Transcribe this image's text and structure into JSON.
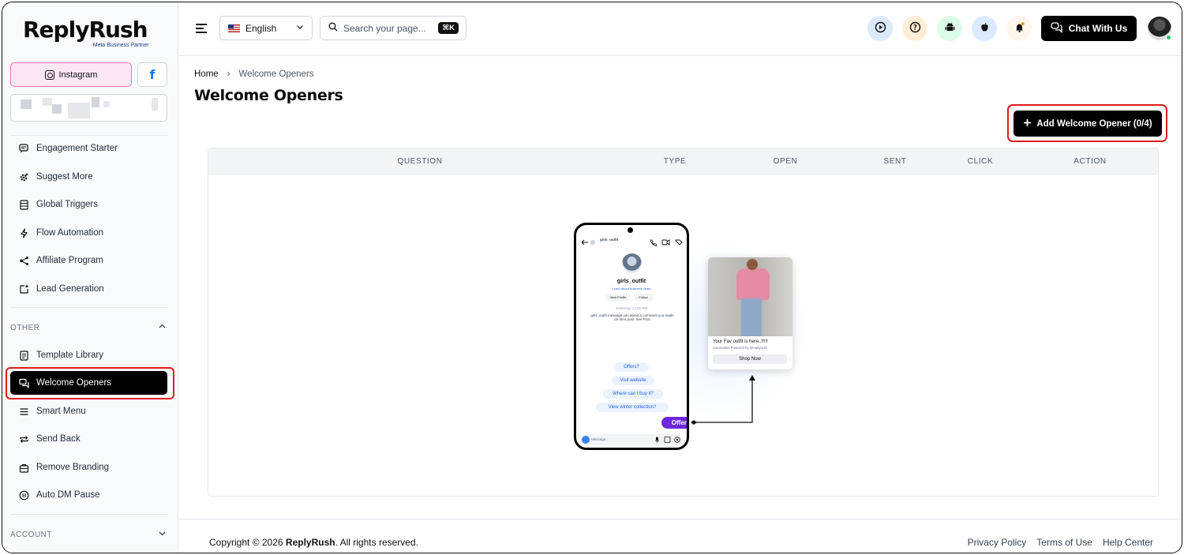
{
  "brand": {
    "name": "ReplyRush",
    "tagline": "Meta Business Partner"
  },
  "social": {
    "instagram_label": "Instagram",
    "facebook_glyph": "f"
  },
  "sidebar": {
    "main_items": [
      {
        "label": "Engagement Starter",
        "icon": "chat-spark-icon"
      },
      {
        "label": "Suggest More",
        "icon": "gear-spark-icon"
      },
      {
        "label": "Global Triggers",
        "icon": "list-icon"
      },
      {
        "label": "Flow Automation",
        "icon": "bolt-icon"
      },
      {
        "label": "Affiliate Program",
        "icon": "share-icon"
      },
      {
        "label": "Lead Generation",
        "icon": "add-box-icon"
      }
    ],
    "other_label": "OTHER",
    "other_items": [
      {
        "label": "Template Library",
        "icon": "document-icon"
      },
      {
        "label": "Welcome Openers",
        "icon": "chat-bubbles-icon",
        "active": true
      },
      {
        "label": "Smart Menu",
        "icon": "menu-icon"
      },
      {
        "label": "Send Back",
        "icon": "repeat-icon"
      },
      {
        "label": "Remove Branding",
        "icon": "bag-icon"
      },
      {
        "label": "Auto DM Pause",
        "icon": "pause-icon"
      }
    ],
    "account_label": "ACCOUNT"
  },
  "header": {
    "language": "English",
    "search_placeholder": "Search your page...",
    "search_shortcut": "⌘K",
    "chat_button": "Chat With Us",
    "icon_colors": [
      "#dbeafe",
      "#ffedd5",
      "#dcfce7",
      "#dbeafe",
      "#fff7ed"
    ]
  },
  "breadcrumb": {
    "home": "Home",
    "separator": "›",
    "current": "Welcome Openers"
  },
  "page": {
    "title": "Welcome Openers",
    "add_button": "Add Welcome Opener (0/4)"
  },
  "table": {
    "columns": [
      "QUESTION",
      "TYPE",
      "OPEN",
      "SENT",
      "CLICK",
      "ACTION"
    ]
  },
  "illustration": {
    "profile_name": "girls_outfit",
    "learn_link": "Learn about business chats",
    "view_profile": "View Profile",
    "follow": "Follow",
    "timestamp": "Yesterday 12:20 PM",
    "message_line": "girls_outfit message you about a comment you made on their post. See Post",
    "chips": [
      "Offers?",
      "Visit website",
      "Where can I buy it?",
      "View winter collection?"
    ],
    "selected_chip": "Offers?",
    "input_placeholder": "Message...",
    "card_title": "Your Fav outfit is here..!!!!!",
    "card_sub": "Automation Powered by @replyrush",
    "card_button": "Shop Now",
    "accent": "#6d28d9"
  },
  "footer": {
    "copyright_prefix": "Copyright © 2026",
    "copyright_brand": "ReplyRush",
    "copyright_suffix": ". All rights reserved.",
    "links": [
      "Privacy Policy",
      "Terms of Use",
      "Help Center"
    ]
  }
}
